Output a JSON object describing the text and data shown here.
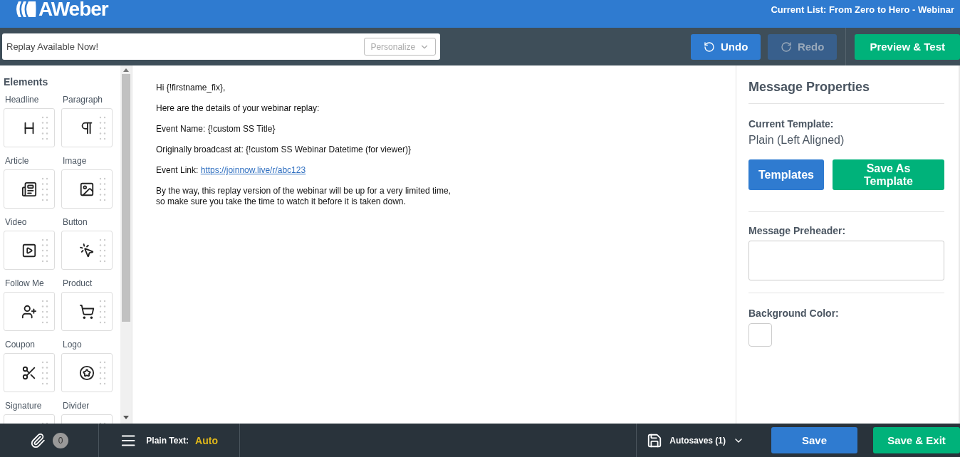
{
  "header": {
    "logo": "AWeber",
    "current_list": "Current List: From Zero to Hero - Webinar"
  },
  "toolbar": {
    "subject": {
      "value": "Replay Available Now!"
    },
    "personalize": "Personalize",
    "buttons": [
      {
        "label": "Undo",
        "kind": "undo",
        "disabled": false
      },
      {
        "label": "Redo",
        "kind": "redo",
        "disabled": true
      },
      {
        "label": "Preview & Test",
        "kind": "preview",
        "disabled": false
      }
    ]
  },
  "elements": {
    "title": "Elements",
    "items": [
      {
        "label": "Headline",
        "kind": "headline"
      },
      {
        "label": "Paragraph",
        "kind": "paragraph"
      },
      {
        "label": "Article",
        "kind": "article"
      },
      {
        "label": "Image",
        "kind": "image"
      },
      {
        "label": "Video",
        "kind": "video"
      },
      {
        "label": "Button",
        "kind": "button"
      },
      {
        "label": "Follow Me",
        "kind": "follow"
      },
      {
        "label": "Product",
        "kind": "product"
      },
      {
        "label": "Coupon",
        "kind": "coupon"
      },
      {
        "label": "Logo",
        "kind": "logo"
      },
      {
        "label": "Signature",
        "kind": "signature"
      },
      {
        "label": "Divider",
        "kind": "divider"
      }
    ]
  },
  "message": {
    "paragraphs": [
      {
        "kind": "text",
        "text": "Hi {!firstname_fix},"
      },
      {
        "kind": "text",
        "text": "Here are the details of your webinar replay:"
      },
      {
        "kind": "text",
        "text": "Event Name: {!custom SS Title}"
      },
      {
        "kind": "text",
        "text": "Originally broadcast at: {!custom SS Webinar Datetime (for viewer)}"
      },
      {
        "kind": "link",
        "text": "Event Link:",
        "link": "https://joinnow.live/r/abc123"
      },
      {
        "kind": "text",
        "text": "By the way, this replay version of the webinar will be up for a very limited time,"
      },
      {
        "kind": "tight",
        "text": "so make sure you take the time to watch it before it is taken down."
      }
    ]
  },
  "properties": {
    "title": "Message Properties",
    "template_label": "Current Template:",
    "template_value": "Plain (Left Aligned)",
    "buttons": [
      {
        "label": "Templates",
        "kind": "blue"
      },
      {
        "label": "Save As Template",
        "kind": "green"
      }
    ],
    "preheader_label": "Message Preheader:",
    "background_label": "Background Color:"
  },
  "footer": {
    "attachments": "0",
    "plain_text_label": "Plain Text:",
    "plain_text_value": "Auto",
    "autosaves": "Autosaves (1)",
    "buttons": [
      {
        "label": "Save",
        "kind": "blue"
      },
      {
        "label": "Save & Exit",
        "kind": "green"
      }
    ]
  }
}
